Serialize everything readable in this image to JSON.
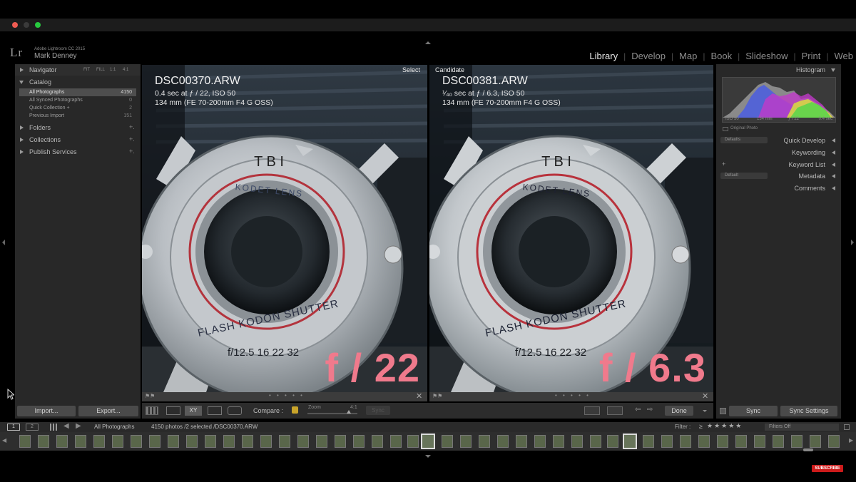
{
  "app": {
    "product": "Adobe Lightroom CC 2015",
    "user": "Mark Denney",
    "logo": "Lr"
  },
  "modules": [
    {
      "label": "Library",
      "active": true
    },
    {
      "label": "Develop",
      "active": false
    },
    {
      "label": "Map",
      "active": false
    },
    {
      "label": "Book",
      "active": false
    },
    {
      "label": "Slideshow",
      "active": false
    },
    {
      "label": "Print",
      "active": false
    },
    {
      "label": "Web",
      "active": false
    }
  ],
  "left_panel": {
    "navigator": {
      "title": "Navigator",
      "zoom_options": [
        "FIT",
        "FILL",
        "1:1",
        "4:1"
      ]
    },
    "catalog": {
      "title": "Catalog",
      "items": [
        {
          "label": "All Photographs",
          "count": "4150",
          "selected": true
        },
        {
          "label": "All Synced Photographs",
          "count": "0",
          "selected": false
        },
        {
          "label": "Quick Collection +",
          "count": "2",
          "selected": false
        },
        {
          "label": "Previous Import",
          "count": "151",
          "selected": false
        }
      ]
    },
    "folders": {
      "title": "Folders",
      "action": "+."
    },
    "collections": {
      "title": "Collections",
      "action": "+."
    },
    "publish": {
      "title": "Publish Services",
      "action": "+."
    },
    "import_label": "Import...",
    "export_label": "Export..."
  },
  "compare": {
    "select": {
      "tag": "Select",
      "filename": "DSC00370.ARW",
      "exposure": "0.4 sec at ƒ / 22, ISO 50",
      "lens": "134 mm (FE 70-200mm F4 G OSS)",
      "fstop": "f / 22"
    },
    "candidate": {
      "tag": "Candidate",
      "filename": "DSC00381.ARW",
      "exposure": "¹⁄₄₀ sec at ƒ / 6.3, ISO 50",
      "lens": "134 mm (FE 70-200mm F4 G OSS)",
      "fstop": "f / 6.3"
    },
    "lens_text": {
      "top": "T B I",
      "brand": "KODET LENS",
      "shutter": "FLASH KODON SHUTTER",
      "apertures": "f/12.5  16  22  32"
    }
  },
  "toolbar": {
    "compare_label": "Compare :",
    "zoom_label": "Zoom",
    "zoom_value": "4:1",
    "swap_label": "Sync",
    "done_label": "Done"
  },
  "right_panel": {
    "histogram": {
      "title": "Histogram",
      "iso": "ISO 50",
      "focal": "134 mm",
      "aperture": "ƒ / 22",
      "shutter": "0.4 sec",
      "original_photo": "Original Photo"
    },
    "quick_develop": {
      "title": "Quick Develop",
      "preset": "Defaults"
    },
    "keywording": {
      "title": "Keywording"
    },
    "keyword_list": {
      "title": "Keyword List",
      "action": "+"
    },
    "metadata": {
      "title": "Metadata",
      "preset": "Default"
    },
    "comments": {
      "title": "Comments"
    },
    "sync_label": "Sync",
    "sync_settings_label": "Sync Settings"
  },
  "filmstrip": {
    "views": [
      "1",
      "2"
    ],
    "source": "All Photographs",
    "status": "4150 photos /2 selected /DSC00370.ARW",
    "filter_label": "Filter :",
    "rating_op": "≥",
    "stars": "★★★★★",
    "filters_off": "Filters Off"
  },
  "watermark": {
    "label": "SUBSCRIBE",
    "color": "#cc1a1a"
  },
  "colors": {
    "panel_bg": "#282828",
    "fstop_text": "#f07a8c",
    "selected_row": "#4e4e4e"
  }
}
